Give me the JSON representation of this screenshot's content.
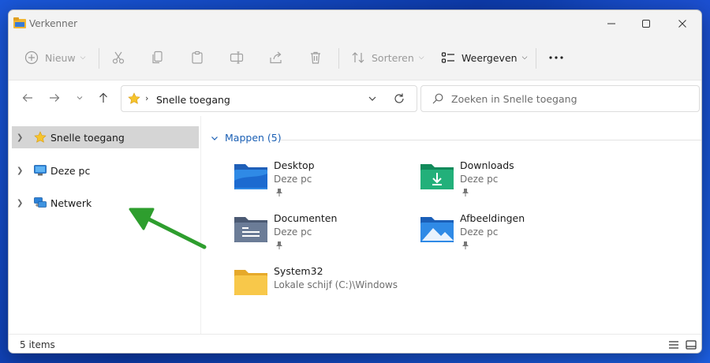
{
  "window": {
    "title": "Verkenner"
  },
  "toolbar": {
    "new_label": "Nieuw",
    "sort_label": "Sorteren",
    "view_label": "Weergeven",
    "icons": [
      "plus-circle-icon",
      "cut-icon",
      "copy-icon",
      "paste-icon",
      "rename-icon",
      "share-icon",
      "delete-icon",
      "sort-icon",
      "view-icon",
      "more-icon"
    ]
  },
  "address": {
    "location": "Snelle toegang"
  },
  "search": {
    "placeholder": "Zoeken in Snelle toegang"
  },
  "navpane": {
    "items": [
      {
        "label": "Snelle toegang",
        "icon": "star-icon",
        "selected": true
      },
      {
        "label": "Deze pc",
        "icon": "computer-icon",
        "selected": false
      },
      {
        "label": "Netwerk",
        "icon": "network-icon",
        "selected": false
      }
    ]
  },
  "group": {
    "title": "Mappen (5)"
  },
  "folders": [
    {
      "name": "Desktop",
      "sub": "Deze pc",
      "pinned": true,
      "icon": "desktop-folder-icon"
    },
    {
      "name": "Downloads",
      "sub": "Deze pc",
      "pinned": true,
      "icon": "downloads-folder-icon"
    },
    {
      "name": "Documenten",
      "sub": "Deze pc",
      "pinned": true,
      "icon": "documents-folder-icon"
    },
    {
      "name": "Afbeeldingen",
      "sub": "Deze pc",
      "pinned": true,
      "icon": "pictures-folder-icon"
    },
    {
      "name": "System32",
      "sub": "Lokale schijf (C:)\\Windows",
      "pinned": false,
      "icon": "folder-icon"
    }
  ],
  "status": {
    "item_count": "5 items"
  },
  "colors": {
    "accent": "#1a5fb4",
    "selection": "#d5d5d5",
    "arrow": "#2e9e2e"
  }
}
